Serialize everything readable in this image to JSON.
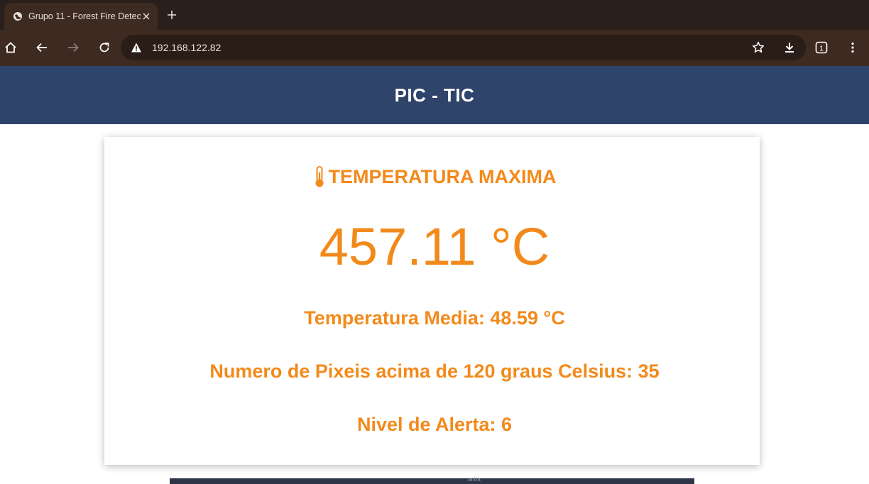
{
  "browser": {
    "tab_title": "Grupo 11 - Forest Fire Detec",
    "url": "192.168.122.82",
    "tab_count": "1"
  },
  "header": {
    "title": "PIC - TIC"
  },
  "card": {
    "heading": "TEMPERATURA MAXIMA",
    "max_temp": "457.11 °C",
    "avg_temp": "Temperatura Media: 48.59 °C",
    "pixels_above": "Numero de Pixeis acima de 120 graus Celsius: 35",
    "alert_level": "Nivel de Alerta: 6"
  },
  "map": {
    "partial_label": "anha"
  },
  "colors": {
    "accent": "#f28a1b",
    "header_bg": "#2f446a",
    "chrome_bg": "#3d2a20"
  }
}
